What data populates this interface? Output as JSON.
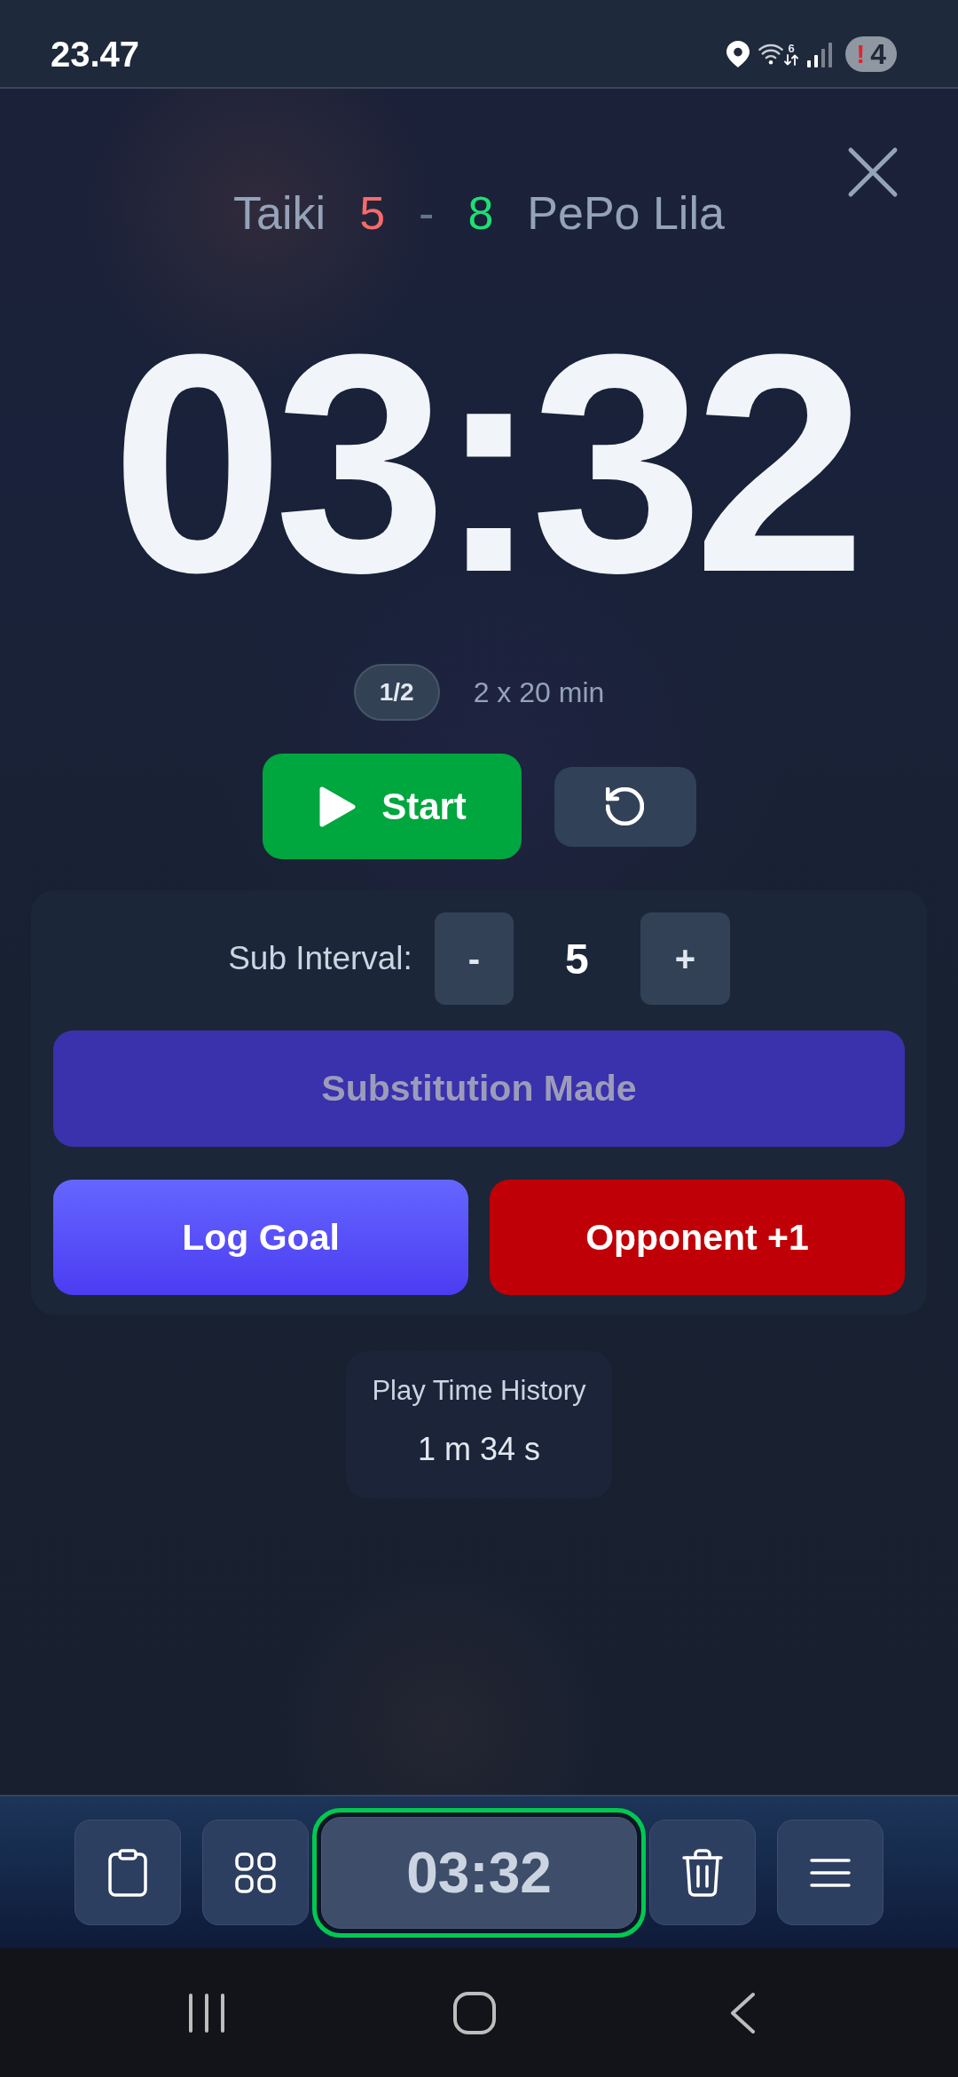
{
  "status_bar": {
    "time": "23.47",
    "wifi_standard": "6",
    "alert": "!",
    "notification_count": "4"
  },
  "header": {
    "teams": [
      {
        "name": "Taiki",
        "score": "5",
        "color": "#f86a6a"
      },
      {
        "name": "PePo Lila",
        "score": "8",
        "color": "#1fdf73"
      }
    ],
    "separator": "-"
  },
  "timer": {
    "display": "03:32"
  },
  "period": {
    "badge": "1/2",
    "format": "2 x 20 min"
  },
  "controls": {
    "start_label": "Start"
  },
  "sub_interval": {
    "label": "Sub Interval:",
    "decrement": "-",
    "value": "5",
    "increment": "+"
  },
  "actions": [
    {
      "kind": "substitution",
      "label": "Substitution Made",
      "disabled": true
    },
    {
      "kind": "goal",
      "label": "Log Goal",
      "disabled": false
    },
    {
      "kind": "opponent",
      "label": "Opponent +1",
      "disabled": false
    }
  ],
  "play_time_history": {
    "title": "Play Time History",
    "value": "1 m 34 s"
  },
  "bottom_bar": {
    "items": [
      {
        "kind": "clipboard",
        "selected": false
      },
      {
        "kind": "grid",
        "selected": false
      },
      {
        "kind": "timer",
        "label": "03:32",
        "selected": true
      },
      {
        "kind": "trash",
        "selected": false
      },
      {
        "kind": "menu",
        "selected": false
      }
    ]
  }
}
